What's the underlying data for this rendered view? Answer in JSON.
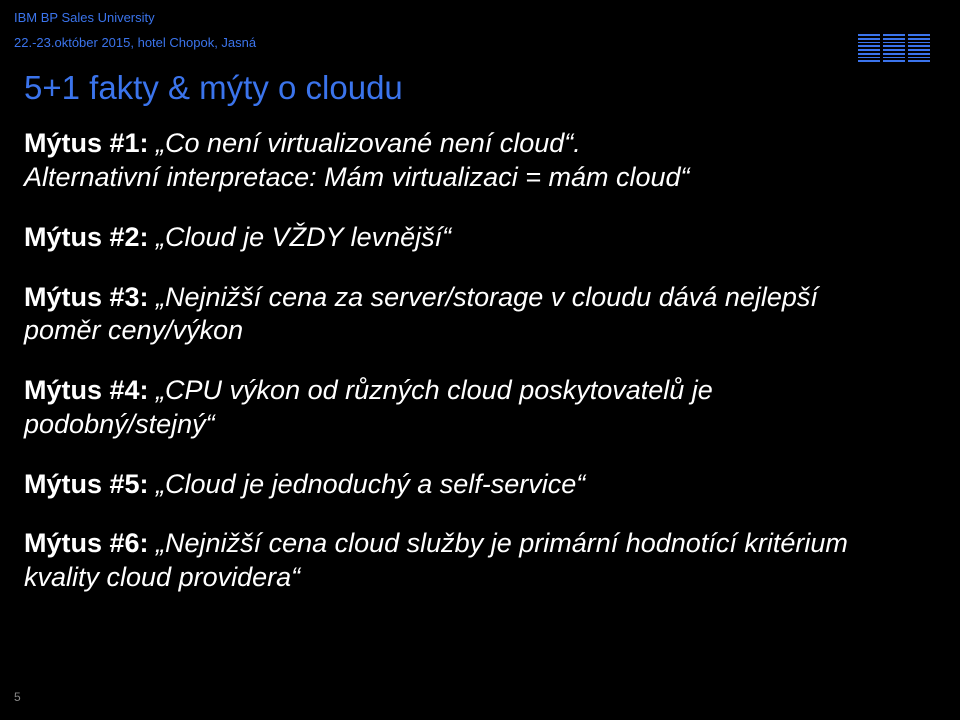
{
  "header": {
    "line1": "IBM BP Sales University",
    "line2": "22.-23.október 2015, hotel Chopok, Jasná"
  },
  "slide_title": "5+1 fakty & mýty o cloudu",
  "myths": [
    {
      "label": "Mýtus #1:",
      "text": " „Co není virtualizované není cloud“. ",
      "sub": "Alternativní interpretace: Mám virtualizaci = mám cloud“"
    },
    {
      "label": "Mýtus #2:",
      "text": " „Cloud je VŽDY levnější“",
      "sub": ""
    },
    {
      "label": "Mýtus #3:",
      "text": " „Nejnižší cena za server/storage v cloudu dává nejlepší poměr ceny/výkon",
      "sub": ""
    },
    {
      "label": "Mýtus #4:",
      "text": " „CPU výkon od různých cloud poskytovatelů je podobný/stejný“",
      "sub": ""
    },
    {
      "label": "Mýtus #5:",
      "text": " „Cloud je jednoduchý a self-service“",
      "sub": ""
    },
    {
      "label": "Mýtus #6:",
      "text": " „Nejnižší cena cloud služby je primární hodnotící kritérium kvality cloud providera“",
      "sub": ""
    }
  ],
  "page_number": "5"
}
